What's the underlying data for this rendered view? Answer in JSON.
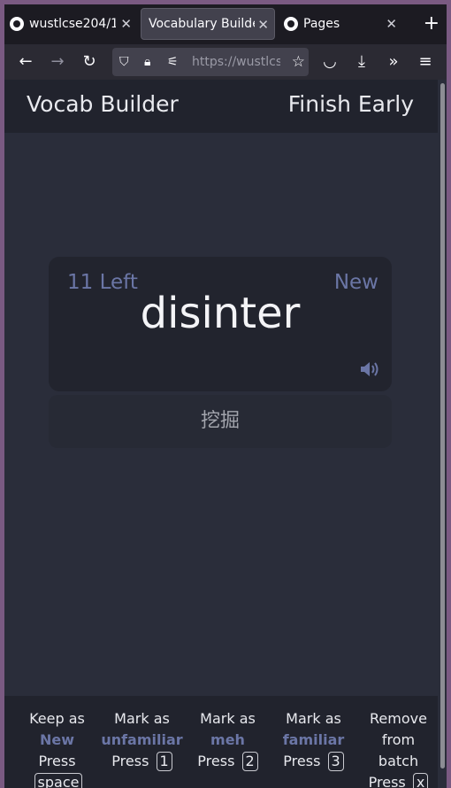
{
  "browser": {
    "tabs": [
      {
        "label": "wustlcse204/1",
        "active": false
      },
      {
        "label": "Vocabulary Builder",
        "active": true
      },
      {
        "label": "Pages",
        "active": false
      }
    ],
    "url": "https://wustlcs"
  },
  "app": {
    "title": "Vocab Builder",
    "finish_label": "Finish Early"
  },
  "card": {
    "left_count": "11 Left",
    "status": "New",
    "word": "disinter",
    "meaning": "挖掘"
  },
  "footer": {
    "actions": [
      {
        "line1": "Keep as",
        "highlight": "New",
        "press": "Press",
        "key": "space"
      },
      {
        "line1": "Mark as",
        "highlight": "unfamiliar",
        "press": "Press",
        "key": "1"
      },
      {
        "line1": "Mark as",
        "highlight": "meh",
        "press": "Press",
        "key": "2"
      },
      {
        "line1": "Mark as",
        "highlight": "familiar",
        "press": "Press",
        "key": "3"
      },
      {
        "line1": "Remove",
        "line2": "from",
        "line3": "batch",
        "press": "Press",
        "key": "x"
      }
    ]
  },
  "colors": {
    "accent": "#6b76a6",
    "background": "#2a2d3a",
    "header": "#21232d",
    "card": "#22242e"
  }
}
